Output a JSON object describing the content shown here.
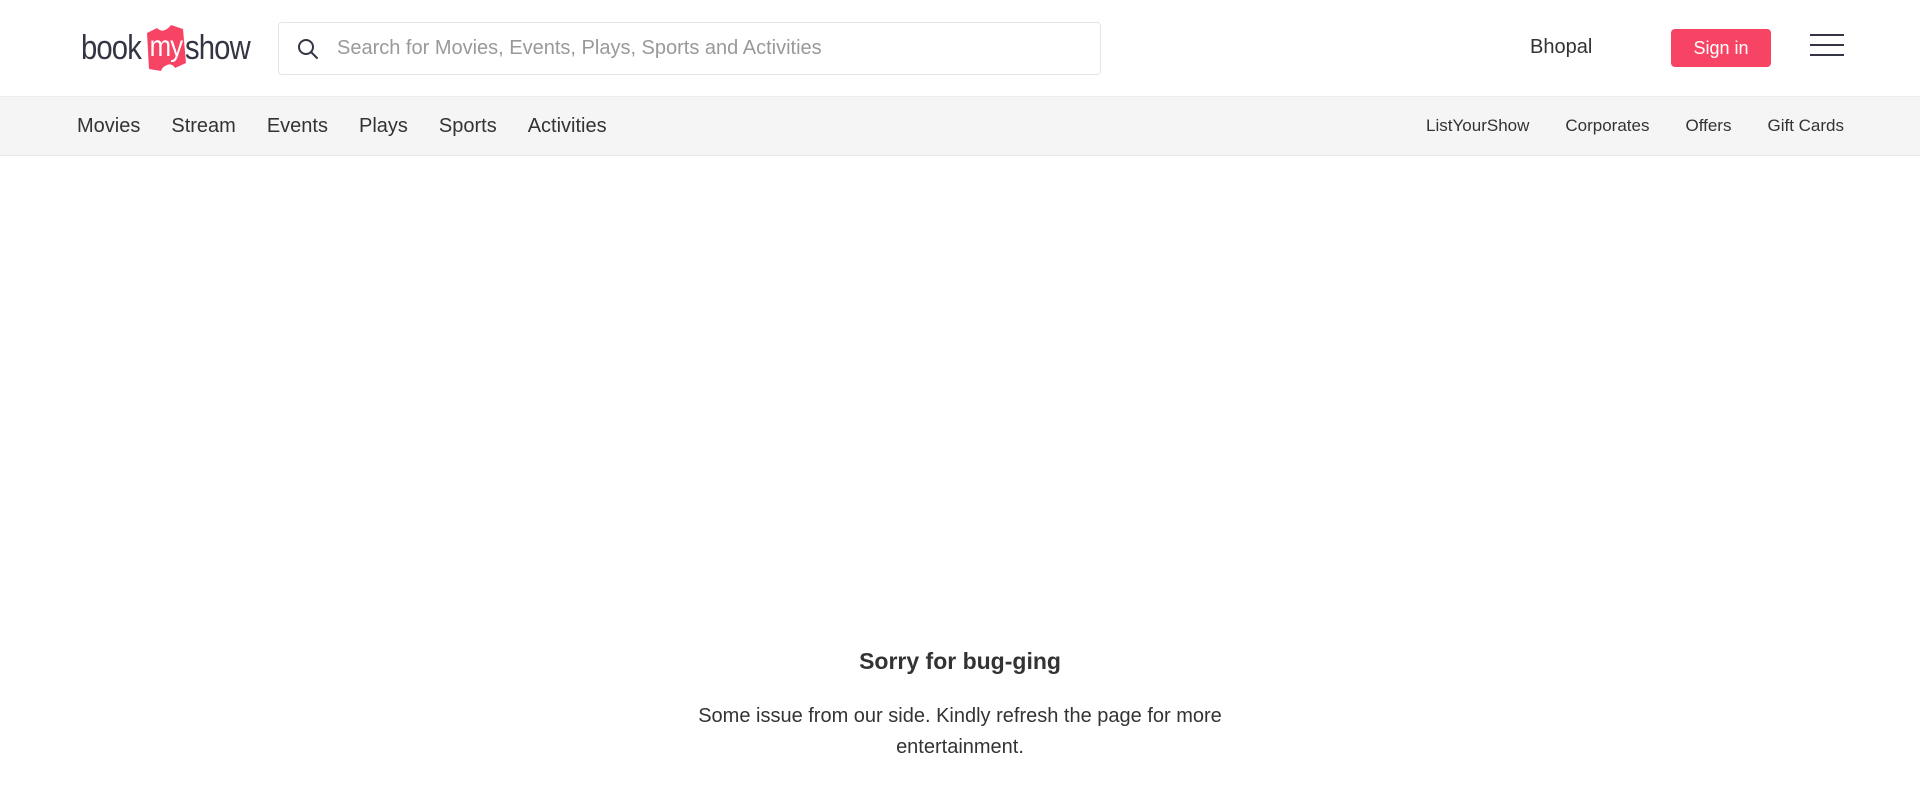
{
  "brand": {
    "logo_text_left": "book",
    "logo_text_badge": "my",
    "logo_text_right": "show",
    "accent_color": "#f84464"
  },
  "header": {
    "search": {
      "placeholder": "Search for Movies, Events, Plays, Sports and Activities",
      "value": "",
      "icon": "search-icon"
    },
    "city": "Bhopal",
    "signin_label": "Sign in",
    "menu_icon": "hamburger-menu-icon"
  },
  "nav": {
    "primary": [
      {
        "label": "Movies"
      },
      {
        "label": "Stream"
      },
      {
        "label": "Events"
      },
      {
        "label": "Plays"
      },
      {
        "label": "Sports"
      },
      {
        "label": "Activities"
      }
    ],
    "secondary": [
      {
        "label": "ListYourShow"
      },
      {
        "label": "Corporates"
      },
      {
        "label": "Offers"
      },
      {
        "label": "Gift Cards"
      }
    ]
  },
  "error": {
    "title": "Sorry for bug-ging",
    "message": "Some issue from our side. Kindly refresh the page for more entertainment."
  }
}
